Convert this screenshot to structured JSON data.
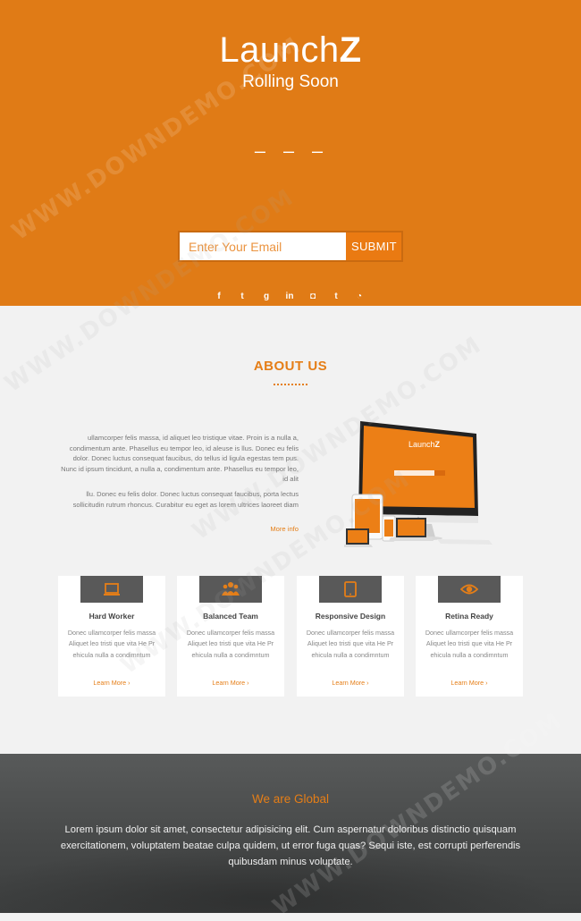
{
  "hero": {
    "logo_light": "Launch",
    "logo_bold": "Z",
    "tagline": "Rolling Soon",
    "countdown": "– – –",
    "email_placeholder": "Enter Your Email",
    "submit_label": "SUBMIT",
    "social": [
      {
        "icon": "facebook-icon",
        "glyph": "f"
      },
      {
        "icon": "twitter-icon",
        "glyph": "t"
      },
      {
        "icon": "google-plus-icon",
        "glyph": "g"
      },
      {
        "icon": "linkedin-icon",
        "glyph": "in"
      },
      {
        "icon": "instagram-icon",
        "glyph": "◘"
      },
      {
        "icon": "tumblr-icon",
        "glyph": "t"
      },
      {
        "icon": "rss-icon",
        "glyph": "◔"
      }
    ]
  },
  "about": {
    "title": "ABOUT US",
    "paragraph1": "ullamcorper felis massa, id aliquet leo tristique vitae. Proin is a nulla a, condimentum ante. Phasellus eu tempor leo, id aleuse is llus. Donec eu felis dolor. Donec luctus consequat faucibus, do tellus id ligula egestas tem pus. Nunc id ipsum tincidunt, a nulla a, condimentum ante. Phasellus eu tempor leo, id alit",
    "paragraph2": "llu. Donec eu felis dolor. Donec luctus consequat faucibus, porta lectus sollicitudin rutrum rhoncus. Curabitur eu eget as lorem ultrices laoreet diam",
    "more_info": "More info"
  },
  "features": [
    {
      "icon": "laptop-icon",
      "title": "Hard Worker",
      "text": "Donec ullamcorper felis massa Aliquet leo tristi que vita He Pr ehicula nulla a condimntum",
      "link": "Learn More ›"
    },
    {
      "icon": "team-icon",
      "title": "Balanced Team",
      "text": "Donec ullamcorper felis massa Aliquet leo tristi que vita He Pr ehicula nulla a condimntum",
      "link": "Learn More ›"
    },
    {
      "icon": "tablet-icon",
      "title": "Responsive Design",
      "text": "Donec ullamcorper felis massa Aliquet leo tristi que vita He Pr ehicula nulla a condimntum",
      "link": "Learn More ›"
    },
    {
      "icon": "eye-icon",
      "title": "Retina Ready",
      "text": "Donec ullamcorper felis massa Aliquet leo tristi que vita He Pr ehicula nulla a condimntum",
      "link": "Learn More ›"
    }
  ],
  "global": {
    "title": "We are Global",
    "text": "Lorem ipsum dolor sit amet, consectetur adipisicing elit. Cum aspernatur doloribus distinctio quisquam exercitationem, voluptatem beatae culpa quidem, ut error fuga quas? Sequi iste, est corrupti perferendis quibusdam minus voluptate."
  },
  "watermark": "WWW.DOWNDEMO.COM",
  "colors": {
    "accent": "#e07b16",
    "dark": "#4a4c4c",
    "icon_box": "#595959"
  }
}
